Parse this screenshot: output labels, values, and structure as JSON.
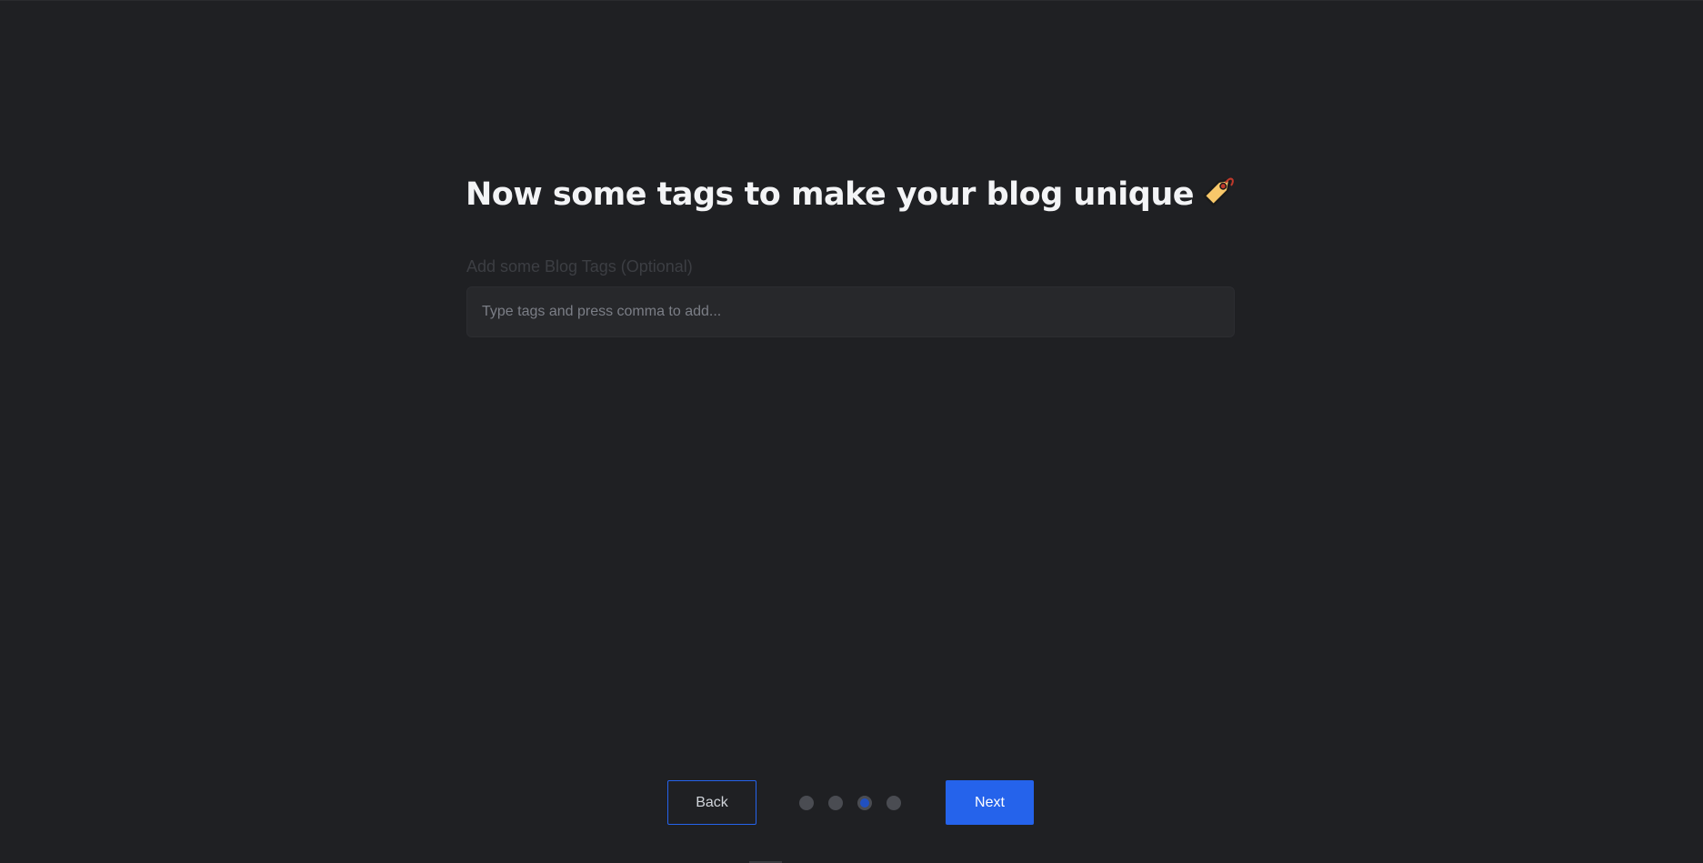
{
  "heading": {
    "text": "Now some tags to make your blog unique",
    "emoji_icon": "label-tag-icon"
  },
  "tags_field": {
    "label": "Add some Blog Tags (Optional)",
    "placeholder": "Type tags and press comma to add...",
    "value": ""
  },
  "navigation": {
    "back_label": "Back",
    "next_label": "Next",
    "steps_total": 4,
    "current_step": 3
  },
  "colors": {
    "background": "#1f2023",
    "accent": "#2563eb",
    "input_background": "#27282b",
    "dot_inactive": "#4a4c52",
    "dot_active": "#2150c0"
  }
}
